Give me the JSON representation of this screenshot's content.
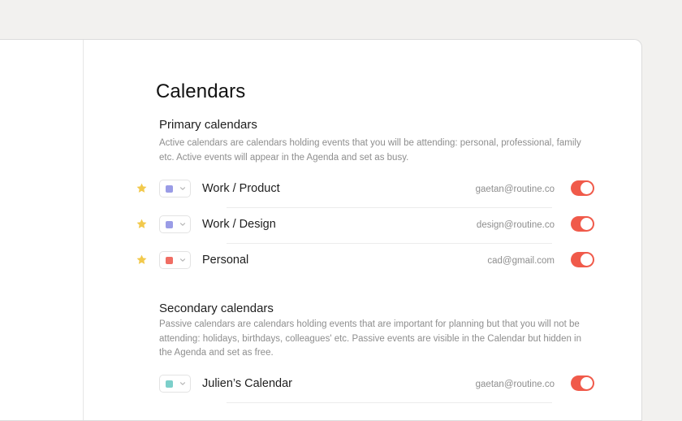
{
  "page": {
    "title": "Calendars"
  },
  "primary": {
    "title": "Primary calendars",
    "description": "Active calendars are calendars holding events that you will be attending: personal, professional, family etc. Active events will appear in the Agenda and set as busy.",
    "calendars": [
      {
        "name": "Work / Product",
        "account": "gaetan@routine.co",
        "color": "#9a9ce6",
        "starred": true,
        "enabled": true
      },
      {
        "name": "Work / Design",
        "account": "design@routine.co",
        "color": "#9a9ce6",
        "starred": true,
        "enabled": true
      },
      {
        "name": "Personal",
        "account": "cad@gmail.com",
        "color": "#f06d63",
        "starred": true,
        "enabled": true
      }
    ]
  },
  "secondary": {
    "title": "Secondary calendars",
    "description": "Passive calendars are calendars holding events that are important for planning but that you will not be attending: holidays, birthdays, colleagues' etc. Passive events are visible in the Calendar but hidden in the Agenda and set as free.",
    "calendars": [
      {
        "name": "Julien’s Calendar",
        "account": "gaetan@routine.co",
        "color": "#7ccfca",
        "starred": false,
        "enabled": true
      }
    ]
  },
  "colors": {
    "toggle_on": "#f05a4a",
    "star": "#f2c94c"
  },
  "icons": {
    "star": "star-icon",
    "chevron": "chevron-down-icon"
  }
}
